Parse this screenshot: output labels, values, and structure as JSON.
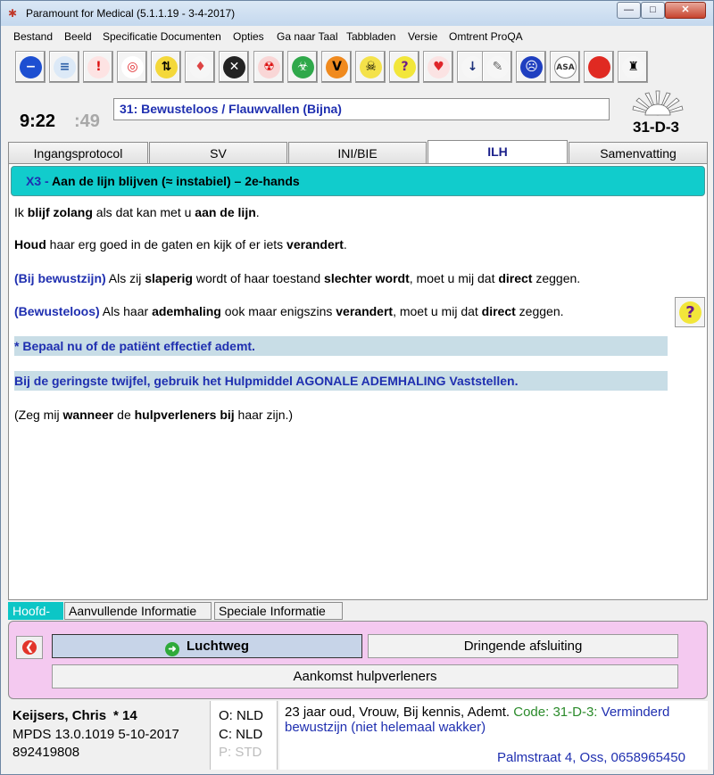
{
  "window": {
    "title": "Paramount for Medical (5.1.1.19 - 3-4-2017)",
    "min": "—",
    "max": "□",
    "close": "✕"
  },
  "menu": [
    "Bestand",
    "Beeld",
    "Specificatie Documenten",
    "Opties",
    "Ga naar Taal",
    "Tabbladen",
    "Versie",
    "Omtrent ProQA"
  ],
  "toolbar": [
    {
      "name": "stop-icon",
      "glyph": "−",
      "bg": "#1d4fd1",
      "fg": "#fff"
    },
    {
      "name": "document-icon",
      "glyph": "≡",
      "bg": "#dce9f7",
      "fg": "#2d5fa8"
    },
    {
      "name": "alert-document-icon",
      "glyph": "!",
      "bg": "#fde3e3",
      "fg": "#d11"
    },
    {
      "name": "target-icon",
      "glyph": "◎",
      "bg": "#fff",
      "fg": "#e0262a"
    },
    {
      "name": "up-down-arrows-icon",
      "glyph": "⇅",
      "bg": "#f4d83a",
      "fg": "#000"
    },
    {
      "name": "person-alert-icon",
      "glyph": "♦",
      "bg": "#f6f6f6",
      "fg": "#d44"
    },
    {
      "name": "cancel-icon",
      "glyph": "✕",
      "bg": "#222",
      "fg": "#fff"
    },
    {
      "name": "radiation-icon",
      "glyph": "☢",
      "bg": "#f9d6d6",
      "fg": "#d11"
    },
    {
      "name": "biohazard-icon",
      "glyph": "☣",
      "bg": "#2fa84a",
      "fg": "#fff"
    },
    {
      "name": "violence-icon",
      "glyph": "V",
      "bg": "#f08a1e",
      "fg": "#000"
    },
    {
      "name": "poison-icon",
      "glyph": "☠",
      "bg": "#f4e24a",
      "fg": "#000"
    },
    {
      "name": "question-icon",
      "glyph": "?",
      "bg": "#f2e63a",
      "fg": "#6b1a8a"
    },
    {
      "name": "heart-hands-icon",
      "glyph": "♥",
      "bg": "#fbe3e3",
      "fg": "#e0262a"
    },
    {
      "name": "download-line-icon",
      "glyph": "↓",
      "bg": "#f6f6f6",
      "fg": "#1a2f7a"
    },
    {
      "name": "needle-icon",
      "glyph": "✎",
      "bg": "#f6f6f6",
      "fg": "#666"
    },
    {
      "name": "face-icon",
      "glyph": "☹",
      "bg": "#1f3fc0",
      "fg": "#fff"
    },
    {
      "name": "asa-icon",
      "glyph": "ASA",
      "bg": "#ffffff",
      "fg": "#333"
    },
    {
      "name": "record-stop-icon",
      "glyph": "●",
      "bg": "#e02a22",
      "fg": "#e02a22"
    },
    {
      "name": "spy-icon",
      "glyph": "♜",
      "bg": "#f6f6f6",
      "fg": "#000"
    }
  ],
  "status": {
    "time_main": "9:22",
    "time_sec": ":49",
    "protocol": "31:  Bewusteloos / Flauwvallen (Bijna)",
    "determinant": "31-D-3"
  },
  "tabs": [
    "Ingangsprotocol",
    "SV",
    "INI/BIE",
    "ILH",
    "Samenvatting"
  ],
  "active_tab": "ILH",
  "section": {
    "code": "X3 -",
    "title": " Aan de lijn blijven (≈ instabiel) – 2e-hands"
  },
  "instructions": {
    "p1": [
      [
        "",
        "Ik "
      ],
      [
        "b",
        "blijf zolang"
      ],
      [
        "",
        " als dat kan met u "
      ],
      [
        "b",
        "aan de lijn"
      ],
      [
        "",
        "."
      ]
    ],
    "p2": [
      [
        "b",
        "Houd"
      ],
      [
        "",
        " haar erg goed in de gaten en kijk of er iets "
      ],
      [
        "b",
        "verandert"
      ],
      [
        "",
        "."
      ]
    ],
    "p3": [
      [
        "blue",
        "(Bij bewustzijn)"
      ],
      [
        "",
        " Als zij "
      ],
      [
        "b",
        "slaperig"
      ],
      [
        "",
        " wordt of haar toestand "
      ],
      [
        "b",
        "slechter wordt"
      ],
      [
        "",
        ", moet u mij dat "
      ],
      [
        "b",
        "direct"
      ],
      [
        "",
        " zeggen."
      ]
    ],
    "p4": [
      [
        "blue",
        "(Bewusteloos)"
      ],
      [
        "",
        " Als haar "
      ],
      [
        "b",
        "ademhaling"
      ],
      [
        "",
        " ook maar enigszins "
      ],
      [
        "b",
        "verandert"
      ],
      [
        "",
        ", moet u mij dat "
      ],
      [
        "b",
        "direct"
      ],
      [
        "",
        " zeggen."
      ]
    ],
    "band1": "*  Bepaal nu of de patiënt effectief ademt.",
    "band2": "Bij de geringste twijfel, gebruik het Hulpmiddel AGONALE ADEMHALING Vaststellen.",
    "p5": [
      [
        "",
        "(Zeg mij "
      ],
      [
        "b",
        "wanneer"
      ],
      [
        "",
        " de "
      ],
      [
        "b",
        "hulpverleners bij"
      ],
      [
        "",
        " haar zijn.)"
      ]
    ]
  },
  "help_glyph": "?",
  "subtabs": [
    "Hoofd-",
    "Aanvullende Informatie",
    "Speciale Informatie"
  ],
  "nav": {
    "back_glyph": "❮",
    "go_glyph": "➜",
    "primary": "Luchtweg",
    "secondary": "Dringende afsluiting",
    "third": "Aankomst hulpverleners"
  },
  "footer": {
    "name": "Keijsers, Chris",
    "name_suffix": " * 14",
    "mpds": "MPDS  13.0.1019  5-10-2017",
    "case_no": "892419808",
    "lang_o": "O: NLD",
    "lang_c": "C: NLD",
    "lang_p": "P: STD",
    "summary_black": "23 jaar oud, Vrouw, Bij kennis, Ademt.",
    "summary_code": " Code: 31-D-3:",
    "summary_desc_1": " Verminderd",
    "summary_desc_2": "bewustzijn (niet helemaal wakker)",
    "address": "Palmstraat 4, Oss, 0658965450"
  },
  "colors": {
    "accent_cyan": "#11cccc",
    "text_blue": "#1f2fb0",
    "panel_pink": "#f4c9f0",
    "code_green": "#2a8a2a"
  }
}
